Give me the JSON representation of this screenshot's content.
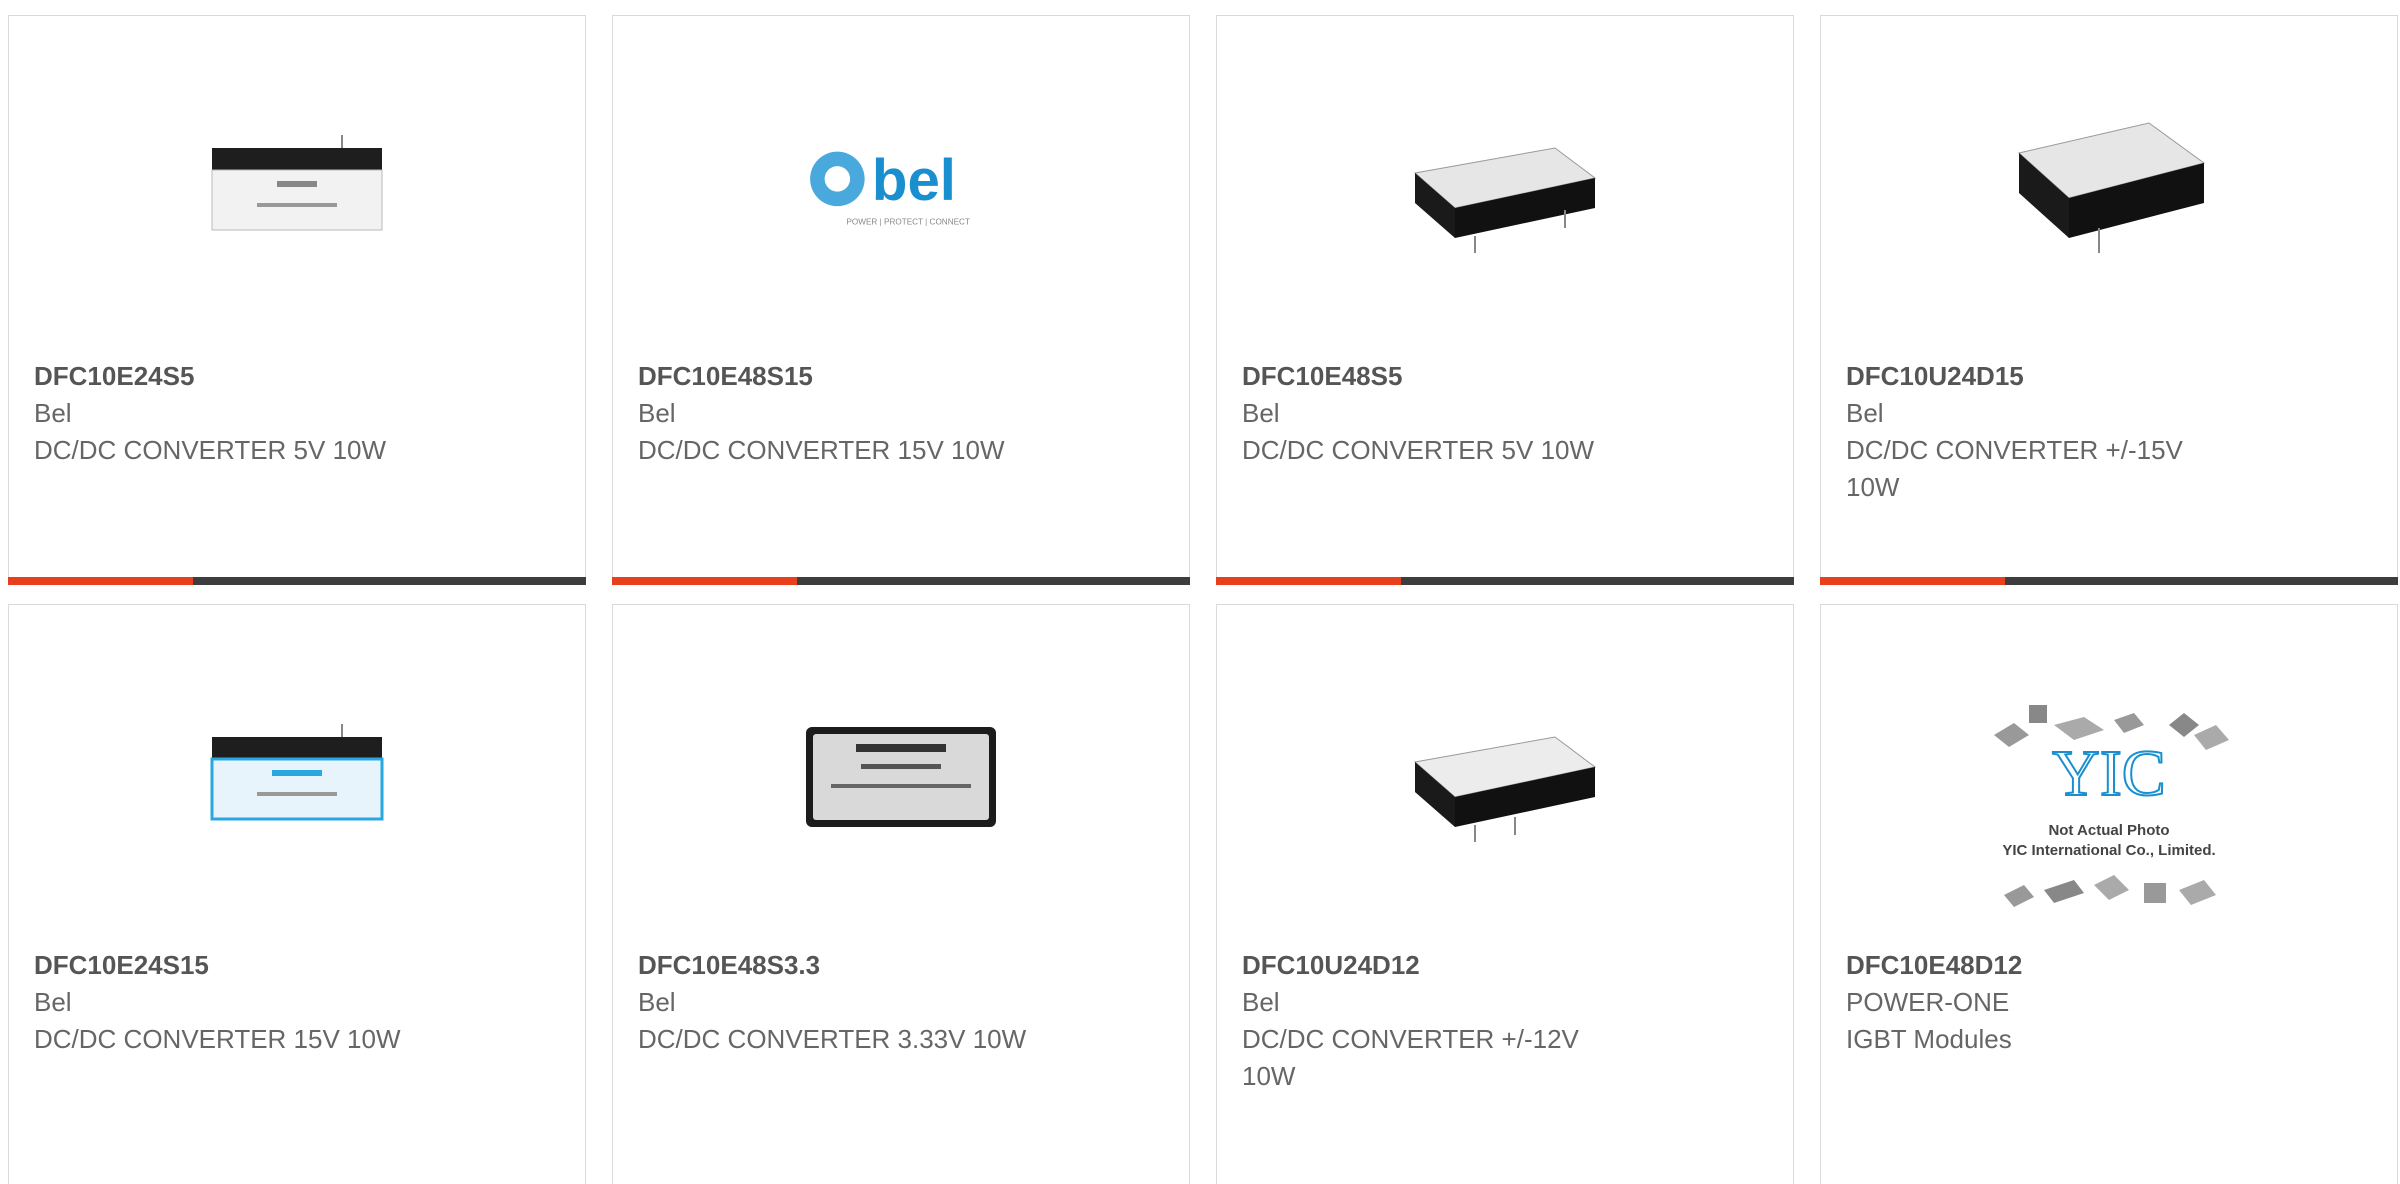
{
  "colors": {
    "accent": "#e8401c",
    "bar": "#3d3d3d"
  },
  "products": [
    {
      "part": "DFC10E24S5",
      "manufacturer": "Bel",
      "description": "DC/DC CONVERTER 5V 10W",
      "image": "white-module-icon",
      "progress": 0.32
    },
    {
      "part": "DFC10E48S15",
      "manufacturer": "Bel",
      "description": "DC/DC CONVERTER 15V 10W",
      "image": "bel-logo-icon",
      "logo_text": "bel",
      "logo_tagline": "POWER | PROTECT | CONNECT",
      "progress": 0.32
    },
    {
      "part": "DFC10E48S5",
      "manufacturer": "Bel",
      "description": "DC/DC CONVERTER 5V 10W",
      "image": "black-module-icon",
      "progress": 0.32
    },
    {
      "part": "DFC10U24D15",
      "manufacturer": "Bel",
      "description": "DC/DC CONVERTER +/-15V 10W",
      "image": "black-module-icon",
      "progress": 0.32
    },
    {
      "part": "DFC10E24S15",
      "manufacturer": "Bel",
      "description": "DC/DC CONVERTER 15V 10W",
      "image": "blue-module-icon"
    },
    {
      "part": "DFC10E48S3.3",
      "manufacturer": "Bel",
      "description": "DC/DC CONVERTER 3.33V 10W",
      "image": "silver-module-icon"
    },
    {
      "part": "DFC10U24D12",
      "manufacturer": "Bel",
      "description": "DC/DC CONVERTER +/-12V 10W",
      "image": "black-module-icon"
    },
    {
      "part": "DFC10E48D12",
      "manufacturer": "POWER-ONE",
      "description": "IGBT Modules",
      "image": "yic-placeholder-icon",
      "placeholder_line1": "Not Actual Photo",
      "placeholder_line2": "YIC International Co., Limited."
    }
  ]
}
